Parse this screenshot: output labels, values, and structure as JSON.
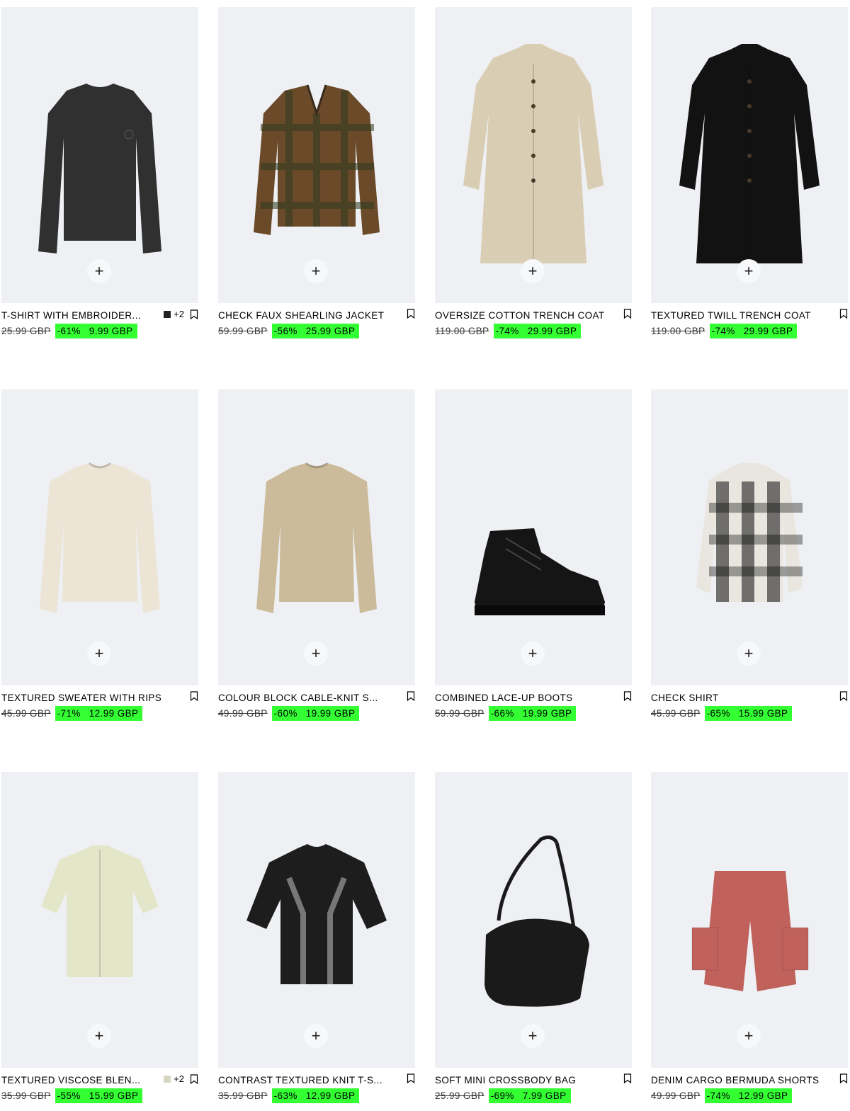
{
  "colors": {
    "image_bg": "#eef0f3",
    "sale_bg": "#33ff33",
    "text": "#000000"
  },
  "products": [
    {
      "title": "T-SHIRT WITH EMBROIDER...",
      "old_price": "25.99 GBP",
      "discount": "-61%",
      "price": "9.99 GBP",
      "swatch": "#222222",
      "more_colors": "+2",
      "icon": "long-sleeve-tshirt-icon",
      "garment_color": "#2f302f"
    },
    {
      "title": "CHECK FAUX SHEARLING JACKET",
      "old_price": "59.99 GBP",
      "discount": "-56%",
      "price": "25.99 GBP",
      "swatch": null,
      "more_colors": null,
      "icon": "jacket-icon",
      "garment_color": "#6b4a2a"
    },
    {
      "title": "OVERSIZE COTTON TRENCH COAT",
      "old_price": "119.00 GBP",
      "discount": "-74%",
      "price": "29.99 GBP",
      "swatch": null,
      "more_colors": null,
      "icon": "coat-icon",
      "garment_color": "#d9cdb4"
    },
    {
      "title": "TEXTURED TWILL TRENCH COAT",
      "old_price": "119.00 GBP",
      "discount": "-74%",
      "price": "29.99 GBP",
      "swatch": null,
      "more_colors": null,
      "icon": "coat-icon",
      "garment_color": "#121212"
    },
    {
      "title": "TEXTURED SWEATER WITH RIPS",
      "old_price": "45.99 GBP",
      "discount": "-71%",
      "price": "12.99 GBP",
      "swatch": null,
      "more_colors": null,
      "icon": "sweater-icon",
      "garment_color": "#ece5d6"
    },
    {
      "title": "COLOUR BLOCK CABLE-KNIT S...",
      "old_price": "49.99 GBP",
      "discount": "-60%",
      "price": "19.99 GBP",
      "swatch": null,
      "more_colors": null,
      "icon": "sweater-icon",
      "garment_color": "#cbbb9a"
    },
    {
      "title": "COMBINED LACE-UP BOOTS",
      "old_price": "59.99 GBP",
      "discount": "-66%",
      "price": "19.99 GBP",
      "swatch": null,
      "more_colors": null,
      "icon": "boot-icon",
      "garment_color": "#151515"
    },
    {
      "title": "CHECK SHIRT",
      "old_price": "45.99 GBP",
      "discount": "-65%",
      "price": "15.99 GBP",
      "swatch": null,
      "more_colors": null,
      "icon": "shirt-icon",
      "garment_color": "#5a5a58"
    },
    {
      "title": "TEXTURED VISCOSE BLEN...",
      "old_price": "35.99 GBP",
      "discount": "-55%",
      "price": "15.99 GBP",
      "swatch": "#d7d4c0",
      "more_colors": "+2",
      "icon": "short-sleeve-shirt-icon",
      "garment_color": "#e3e6c8"
    },
    {
      "title": "CONTRAST TEXTURED KNIT T-S...",
      "old_price": "35.99 GBP",
      "discount": "-63%",
      "price": "12.99 GBP",
      "swatch": null,
      "more_colors": null,
      "icon": "tshirt-icon",
      "garment_color": "#1d1d1d"
    },
    {
      "title": "SOFT MINI CROSSBODY BAG",
      "old_price": "25.99 GBP",
      "discount": "-69%",
      "price": "7.99 GBP",
      "swatch": null,
      "more_colors": null,
      "icon": "bag-icon",
      "garment_color": "#1a1a1a"
    },
    {
      "title": "DENIM CARGO BERMUDA SHORTS",
      "old_price": "49.99 GBP",
      "discount": "-74%",
      "price": "12.99 GBP",
      "swatch": null,
      "more_colors": null,
      "icon": "shorts-icon",
      "garment_color": "#c0615c"
    }
  ],
  "add_label": "+"
}
